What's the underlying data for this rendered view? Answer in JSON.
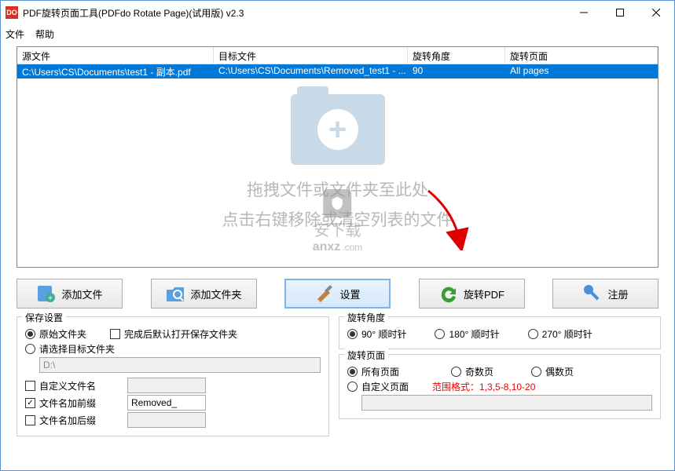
{
  "window": {
    "icon_text": "DO",
    "title": "PDF旋转页面工具(PDFdo Rotate Page)(试用版) v2.3"
  },
  "menu": {
    "file": "文件",
    "help": "帮助"
  },
  "grid": {
    "headers": {
      "source": "源文件",
      "target": "目标文件",
      "angle": "旋转角度",
      "pages": "旋转页面"
    },
    "rows": [
      {
        "source": "C:\\Users\\CS\\Documents\\test1 - 副本.pdf",
        "target": "C:\\Users\\CS\\Documents\\Removed_test1 - ...",
        "angle": "90",
        "pages": "All pages"
      }
    ]
  },
  "dropzone": {
    "line1": "拖拽文件或文件夹至此处",
    "line2": "点击右键移除或清空列表的文件"
  },
  "watermark": {
    "big": "安下载",
    "anxz": "anxz",
    "com": ".com"
  },
  "toolbar": {
    "add_file": "添加文件",
    "add_folder": "添加文件夹",
    "settings": "设置",
    "rotate": "旋转PDF",
    "register": "注册"
  },
  "save_settings": {
    "title": "保存设置",
    "orig_folder": "原始文件夹",
    "open_after": "完成后默认打开保存文件夹",
    "choose_folder": "请选择目标文件夹",
    "path": "D:\\",
    "custom_name": "自定义文件名",
    "add_prefix": "文件名加前缀",
    "prefix_value": "Removed_",
    "add_suffix": "文件名加后缀"
  },
  "rotate_angle": {
    "title": "旋转角度",
    "r90": "90° 顺时针",
    "r180": "180° 顺时针",
    "r270": "270° 顺时针"
  },
  "rotate_pages": {
    "title": "旋转页面",
    "all": "所有页面",
    "odd": "奇数页",
    "even": "偶数页",
    "custom": "自定义页面",
    "range_hint": "范围格式：1,3,5-8,10-20"
  }
}
